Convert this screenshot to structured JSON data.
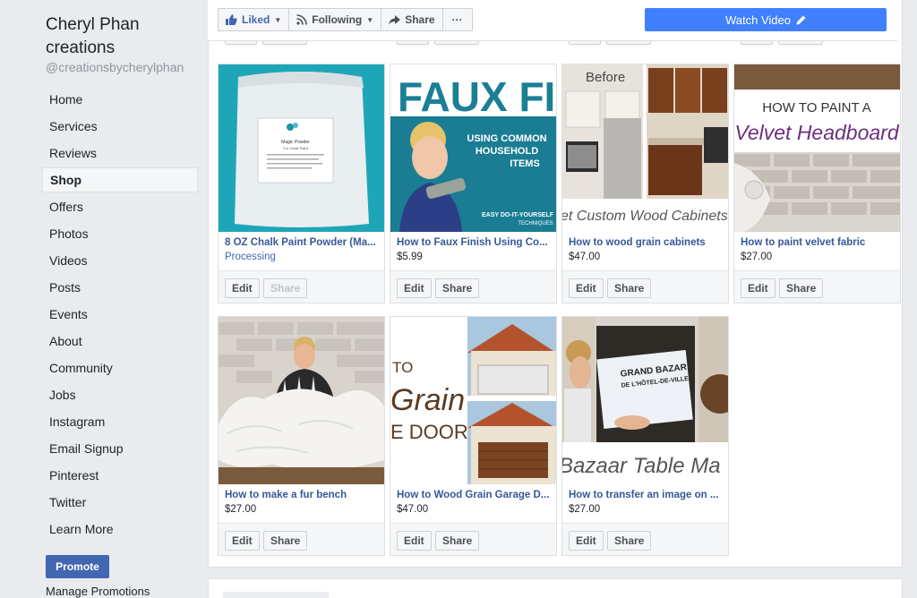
{
  "page": {
    "name": "Cheryl Phan creations",
    "handle": "@creationsbycherylphan"
  },
  "sidebar": {
    "items": [
      {
        "label": "Home"
      },
      {
        "label": "Services"
      },
      {
        "label": "Reviews"
      },
      {
        "label": "Shop",
        "active": true
      },
      {
        "label": "Offers"
      },
      {
        "label": "Photos"
      },
      {
        "label": "Videos"
      },
      {
        "label": "Posts"
      },
      {
        "label": "Events"
      },
      {
        "label": "About"
      },
      {
        "label": "Community"
      },
      {
        "label": "Jobs"
      },
      {
        "label": "Instagram"
      },
      {
        "label": "Email Signup"
      },
      {
        "label": "Pinterest"
      },
      {
        "label": "Twitter"
      },
      {
        "label": "Learn More"
      }
    ],
    "promote_label": "Promote",
    "manage_label": "Manage Promotions"
  },
  "action_bar": {
    "liked_label": "Liked",
    "following_label": "Following",
    "share_label": "Share",
    "more_label": "···",
    "watch_label": "Watch Video"
  },
  "products": [
    {
      "title": "8 OZ Chalk Paint Powder (Ma...",
      "price": "Processing",
      "edit": "Edit",
      "share": "Share",
      "share_disabled": true,
      "image_text": {
        "label_line1": "Magic Powder",
        "label_line2": "For Chalk Paint"
      }
    },
    {
      "title": "How to Faux Finish Using Co...",
      "price": "$5.99",
      "edit": "Edit",
      "share": "Share",
      "image_text": {
        "headline": "FAUX FINISH",
        "sub1": "USING COMMON",
        "sub2": "HOUSEHOLD",
        "sub3": "ITEMS",
        "foot1": "EASY DO-IT-YOURSELF",
        "foot2": "TECHNIQUES"
      }
    },
    {
      "title": "How to wood grain cabinets",
      "price": "$47.00",
      "edit": "Edit",
      "share": "Share",
      "image_text": {
        "before": "Before",
        "caption": "et Custom Wood Cabinets o"
      }
    },
    {
      "title": "How to paint velvet fabric",
      "price": "$27.00",
      "edit": "Edit",
      "share": "Share",
      "image_text": {
        "line1": "HOW TO PAINT A",
        "line2": "Velvet Headboard"
      }
    },
    {
      "title": "How to make a fur bench",
      "price": "$27.00",
      "edit": "Edit",
      "share": "Share",
      "image_text": {}
    },
    {
      "title": "How to Wood Grain Garage D...",
      "price": "$47.00",
      "edit": "Edit",
      "share": "Share",
      "image_text": {
        "line1": "TO",
        "line2": "Grain",
        "line3": "E DOORS"
      }
    },
    {
      "title": "How to transfer an image on ...",
      "price": "$27.00",
      "edit": "Edit",
      "share": "Share",
      "image_text": {
        "sign1": "GRAND BAZAR",
        "sign2": "DE L'HÔTEL-DE-VILLE",
        "caption": "Bazaar Table Ma"
      }
    }
  ],
  "colors": {
    "accent": "#4267b2",
    "watch_button": "#4080ff",
    "link": "#365899",
    "background": "#e9ebee"
  }
}
